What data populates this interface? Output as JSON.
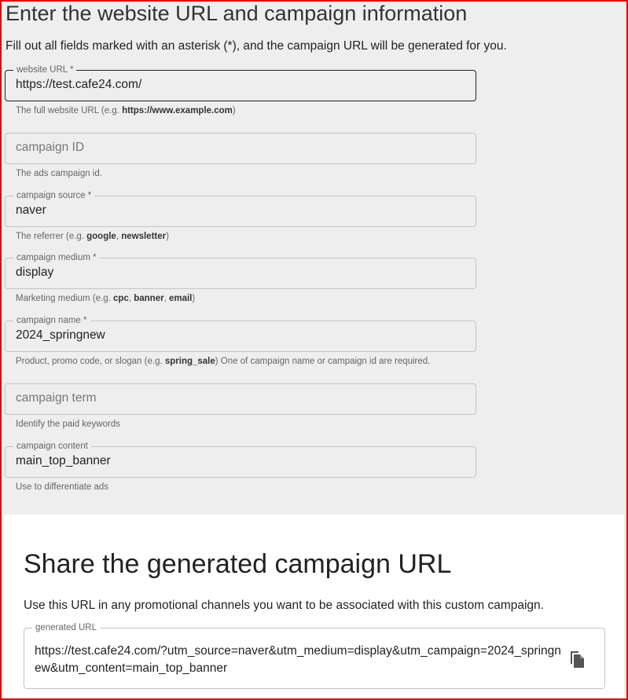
{
  "form": {
    "title": "Enter the website URL and campaign information",
    "description": "Fill out all fields marked with an asterisk (*), and the campaign URL will be generated for you.",
    "fields": [
      {
        "label": "website URL *",
        "value": "https://test.cafe24.com/",
        "placeholder": "",
        "helper_pre": "The full website URL (e.g. ",
        "helper_bold": "https://www.example.com",
        "helper_post": ")"
      },
      {
        "label": "",
        "value": "",
        "placeholder": "campaign ID",
        "helper": "The ads campaign id."
      },
      {
        "label": "campaign source *",
        "value": "naver",
        "helper_pre": "The referrer (e.g. ",
        "helper_bold1": "google",
        "helper_sep": ", ",
        "helper_bold2": "newsletter",
        "helper_post": ")"
      },
      {
        "label": "campaign medium *",
        "value": "display",
        "helper_pre": "Marketing medium (e.g. ",
        "helper_bold1": "cpc",
        "helper_sep1": ", ",
        "helper_bold2": "banner",
        "helper_sep2": ", ",
        "helper_bold3": "email",
        "helper_post": ")"
      },
      {
        "label": "campaign name *",
        "value": "2024_springnew",
        "helper_pre": "Product, promo code, or slogan (e.g. ",
        "helper_bold": "spring_sale",
        "helper_post": ") One of campaign name or campaign id are required."
      },
      {
        "label": "",
        "value": "",
        "placeholder": "campaign term",
        "helper": "Identify the paid keywords"
      },
      {
        "label": "campaign content",
        "value": "main_top_banner",
        "helper": "Use to differentiate ads"
      }
    ]
  },
  "share": {
    "title": "Share the generated campaign URL",
    "description": "Use this URL in any promotional channels you want to be associated with this custom campaign.",
    "generated_label": "generated URL",
    "generated_url": "https://test.cafe24.com/?utm_source=naver&utm_medium=display&utm_campaign=2024_springnew&utm_content=main_top_banner",
    "copy_icon": "copy-icon"
  },
  "colors": {
    "frame_border": "#e00000",
    "page_bg": "#eeeeee",
    "card_bg": "#ffffff"
  }
}
